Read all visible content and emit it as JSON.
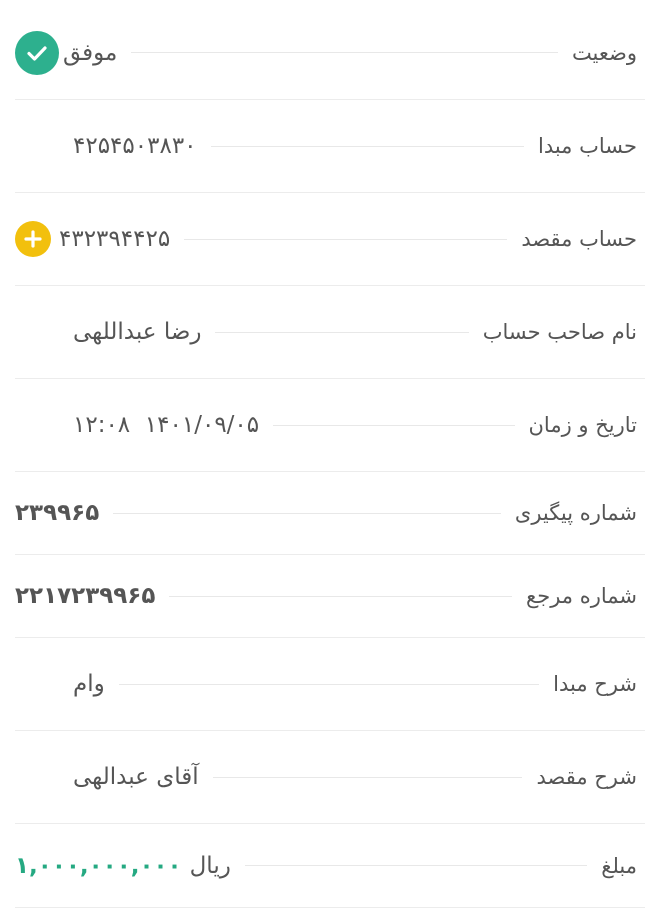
{
  "rows": [
    {
      "label": "وضعیت",
      "value": "موفق"
    },
    {
      "label": "حساب مبدا",
      "value": "۴۲۵۴۵۰۳۸۳۰"
    },
    {
      "label": "حساب مقصد",
      "value": "۴۳۲۳۹۴۴۲۵"
    },
    {
      "label": "نام صاحب حساب",
      "value": "رضا عبداللهی"
    },
    {
      "label": "تاریخ و زمان",
      "value": "۱۴۰۱/۰۹/۰۵  ۱۲:۰۸"
    },
    {
      "label": "شماره پیگیری",
      "value": "۲۳۹۹۶۵"
    },
    {
      "label": "شماره مرجع",
      "value": "۲۲۱۷۲۳۹۹۶۵"
    },
    {
      "label": "شرح مبدا",
      "value": "وام"
    },
    {
      "label": "شرح مقصد",
      "value": "آقای عبدالهی"
    },
    {
      "label": "مبلغ",
      "value": "۱,۰۰۰,۰۰۰,۰۰۰",
      "currency": "ریال"
    }
  ],
  "icons": {
    "status": "check-circle-icon",
    "dest_account": "add-circle-icon"
  },
  "colors": {
    "success": "#2db08e",
    "add": "#f2c00d",
    "amount": "#25a982"
  }
}
